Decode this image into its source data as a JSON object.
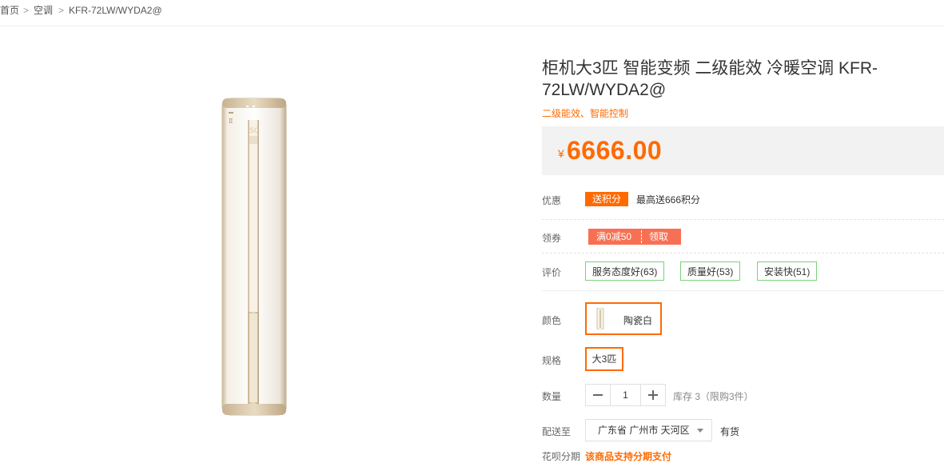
{
  "breadcrumb": {
    "items": [
      "首页",
      "空调",
      "KFR-72LW/WYDA2@"
    ],
    "separator": ">"
  },
  "product": {
    "title": "柜机大3匹 智能变频 二级能效 冷暖空调 KFR-72LW/WYDA2@",
    "subtitle": "二级能效、智能控制",
    "image_icon": "tower-air-conditioner-image"
  },
  "price": {
    "currency": "¥",
    "value": "6666.00",
    "color": "#ff6a00"
  },
  "promotion": {
    "label": "优惠",
    "tag": "送积分",
    "text": "最高送666积分"
  },
  "coupon": {
    "label": "领券",
    "text": "满0减50",
    "action": "领取"
  },
  "reviews": {
    "label": "评价",
    "tags": [
      "服务态度好(63)",
      "质量好(53)",
      "安装快(51)"
    ]
  },
  "color": {
    "label": "颜色",
    "selected": "陶瓷白"
  },
  "spec": {
    "label": "规格",
    "selected": "大3匹"
  },
  "quantity": {
    "label": "数量",
    "value": "1",
    "stock_text": "库存 3（限购3件）"
  },
  "delivery": {
    "label": "配送至",
    "region": "广东省 广州市 天河区",
    "availability": "有货"
  },
  "installment": {
    "label": "花呗分期",
    "text": "该商品支持分期支付"
  },
  "colors": {
    "accent": "#ff6a00",
    "coupon": "#f87054",
    "review_border": "#7bd17b",
    "price_bg": "#f2f2f2"
  }
}
